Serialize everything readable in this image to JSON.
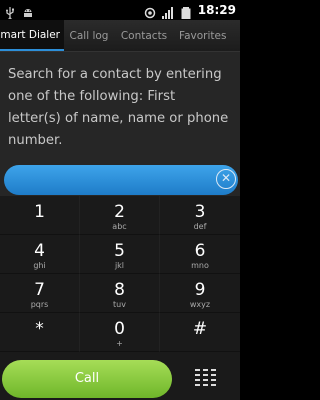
{
  "status_bar": {
    "time": "18:29",
    "icons": [
      "usb-icon",
      "android-icon",
      "sync-icon",
      "signal-icon",
      "battery-icon"
    ]
  },
  "tabs": [
    {
      "label": "Smart Dialer",
      "active": true
    },
    {
      "label": "Call log",
      "active": false
    },
    {
      "label": "Contacts",
      "active": false
    },
    {
      "label": "Favorites",
      "active": false
    }
  ],
  "hint_text": "Search for a contact by entering one of the following: First letter(s) of name, name or phone number.",
  "number_field": {
    "value": "",
    "clear_icon": "clear-icon"
  },
  "keypad": [
    {
      "digit": "1",
      "letters": ""
    },
    {
      "digit": "2",
      "letters": "abc"
    },
    {
      "digit": "3",
      "letters": "def"
    },
    {
      "digit": "4",
      "letters": "ghi"
    },
    {
      "digit": "5",
      "letters": "jkl"
    },
    {
      "digit": "6",
      "letters": "mno"
    },
    {
      "digit": "7",
      "letters": "pqrs"
    },
    {
      "digit": "8",
      "letters": "tuv"
    },
    {
      "digit": "9",
      "letters": "wxyz"
    },
    {
      "digit": "*",
      "letters": ""
    },
    {
      "digit": "0",
      "letters": "+"
    },
    {
      "digit": "#",
      "letters": ""
    }
  ],
  "call_button": {
    "label": "Call"
  },
  "colors": {
    "accent_blue": "#2d8fd9",
    "call_green": "#8cc63f"
  }
}
